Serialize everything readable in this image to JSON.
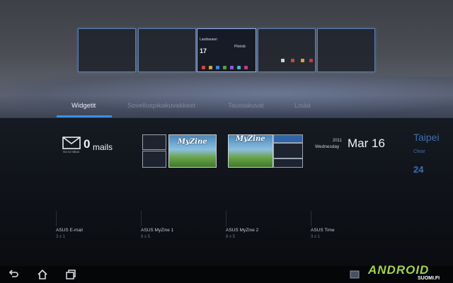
{
  "screens": {
    "active_panel": {
      "city": "Lauttasaari",
      "temp": "17",
      "widget_label": "Pilvistä"
    }
  },
  "tabs": [
    {
      "label": "Widgetit"
    },
    {
      "label": "Sovelluspikakuvakkeet"
    },
    {
      "label": "Taustakuvat"
    },
    {
      "label": "Lisää"
    }
  ],
  "email_widget": {
    "count": "0",
    "word": "mails",
    "sub": "Go to Inbox"
  },
  "time_widget": {
    "year": "2011",
    "weekday": "Wednesday",
    "date": "Mar 16"
  },
  "weather_widget": {
    "city": "Taipei",
    "condition": "Clear",
    "temp": "24"
  },
  "widgets": [
    {
      "name": "ASUS E-mail",
      "size": "3 x 1"
    },
    {
      "name": "ASUS MyZine 1",
      "size": "8 x 5"
    },
    {
      "name": "ASUS MyZine 2",
      "size": "8 x 5"
    },
    {
      "name": "ASUS Time",
      "size": "3 x 1"
    }
  ],
  "myzine_logo": "MyZine",
  "brand": {
    "main": "ANDROID",
    "sub": "SUOMI.FI"
  },
  "colors": {
    "accent": "#3a8ee6",
    "brand_green": "#9fd34a"
  }
}
